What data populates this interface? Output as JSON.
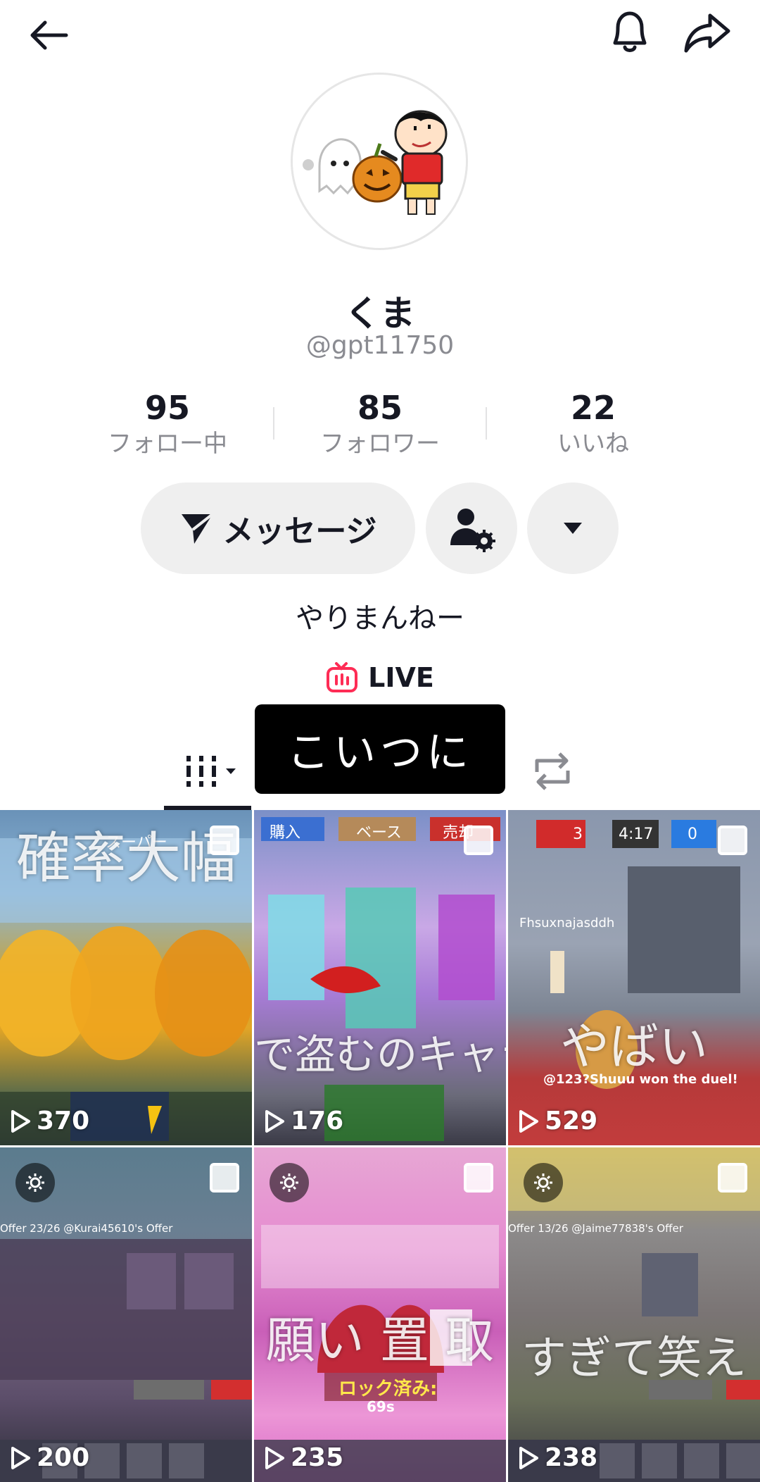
{
  "profile": {
    "name": "くま",
    "handle": "@gpt11750",
    "bio": "やりまんねー"
  },
  "stats": [
    {
      "value": "95",
      "label": "フォロー中"
    },
    {
      "value": "85",
      "label": "フォロワー"
    },
    {
      "value": "22",
      "label": "いいね"
    }
  ],
  "actions": {
    "message_label": "メッセージ"
  },
  "live": {
    "label": "LIVE"
  },
  "tooltip": {
    "text": "こいつに"
  },
  "videos": [
    {
      "plays": "370",
      "caption": "確率大幅"
    },
    {
      "plays": "176",
      "caption": "で盗むのキャラ"
    },
    {
      "plays": "529",
      "caption": "やばい"
    },
    {
      "plays": "200",
      "caption": ""
    },
    {
      "plays": "235",
      "caption": "願い 置 取"
    },
    {
      "plays": "238",
      "caption": "すぎて笑え"
    }
  ],
  "hud": {
    "tile1_tag": "スーパー",
    "tile2_tabs": [
      "購入",
      "ベース",
      "売却"
    ],
    "tile3_score": [
      "3",
      "4:17",
      "0"
    ],
    "tile3_name": "Fhsuxnajasddh",
    "tile3_win": "@123?Shuuu won the duel!",
    "tile4_offer": "Offer 23/26 @Kurai45610's Offer",
    "tile5_lock": "ロック済み:",
    "tile5_timer": "69s",
    "tile6_offer": "Offer 13/26 @Jaime77838's Offer"
  },
  "colors": {
    "accent_live": "#fe2c55",
    "muted": "#8a8b91",
    "button_bg": "#efefef"
  },
  "icons": [
    "back-arrow-icon",
    "bell-icon",
    "share-icon",
    "send-icon",
    "person-settings-icon",
    "chevron-down-icon",
    "live-tv-icon",
    "grid-view-icon",
    "repost-icon",
    "play-icon",
    "gear-icon",
    "multi-photo-icon"
  ]
}
